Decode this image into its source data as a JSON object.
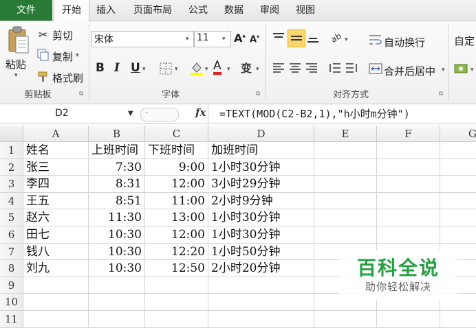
{
  "menu": {
    "tabs": [
      "文件",
      "开始",
      "插入",
      "页面布局",
      "公式",
      "数据",
      "审阅",
      "视图"
    ]
  },
  "ribbon": {
    "clipboard": {
      "paste": "粘贴",
      "cut": "剪切",
      "copy": "复制",
      "format_painter": "格式刷",
      "group": "剪贴板"
    },
    "font": {
      "name": "宋体",
      "size": "11",
      "bold": "B",
      "italic": "I",
      "underline": "U",
      "group": "字体"
    },
    "alignment": {
      "wrap": "自动换行",
      "merge": "合并后居中",
      "group": "对齐方式"
    },
    "right_cut": "自定"
  },
  "formula_bar": {
    "cell_ref": "D2",
    "fx": "fx",
    "formula": "=TEXT(MOD(C2-B2,1),\"h小时m分钟\")"
  },
  "sheet": {
    "columns": [
      "A",
      "B",
      "C",
      "D",
      "E",
      "F",
      "G"
    ],
    "rows": [
      "1",
      "2",
      "3",
      "4",
      "5",
      "6",
      "7",
      "8",
      "9",
      "10",
      "11"
    ],
    "header": [
      "姓名",
      "上班时间",
      "下班时间",
      "加班时间"
    ],
    "data": [
      [
        "张三",
        "7:30",
        "9:00",
        "1小时30分钟"
      ],
      [
        "李四",
        "8:31",
        "12:00",
        "3小时29分钟"
      ],
      [
        "王五",
        "8:51",
        "11:00",
        "2小时9分钟"
      ],
      [
        "赵六",
        "11:30",
        "13:00",
        "1小时30分钟"
      ],
      [
        "田七",
        "10:30",
        "12:00",
        "1小时30分钟"
      ],
      [
        "钱八",
        "10:30",
        "12:20",
        "1小时50分钟"
      ],
      [
        "刘九",
        "10:30",
        "12:50",
        "2小时20分钟"
      ]
    ]
  },
  "watermark": {
    "title": "百科全说",
    "subtitle": "助你轻松解决"
  }
}
